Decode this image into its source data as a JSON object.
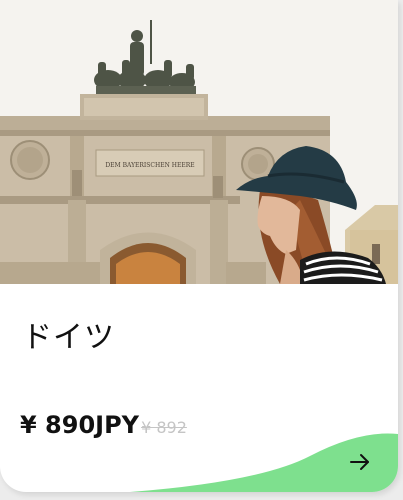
{
  "card": {
    "title": "ドイツ",
    "price": "¥ 890JPY",
    "old_price": "¥ 892"
  },
  "hero_image": {
    "inscription": "DEM BAYERISCHEN HEERE"
  },
  "colors": {
    "accent": "#7ee08e",
    "text": "#111111",
    "muted": "#c5c5c5"
  },
  "icons": {
    "next": "arrow-right-icon"
  }
}
